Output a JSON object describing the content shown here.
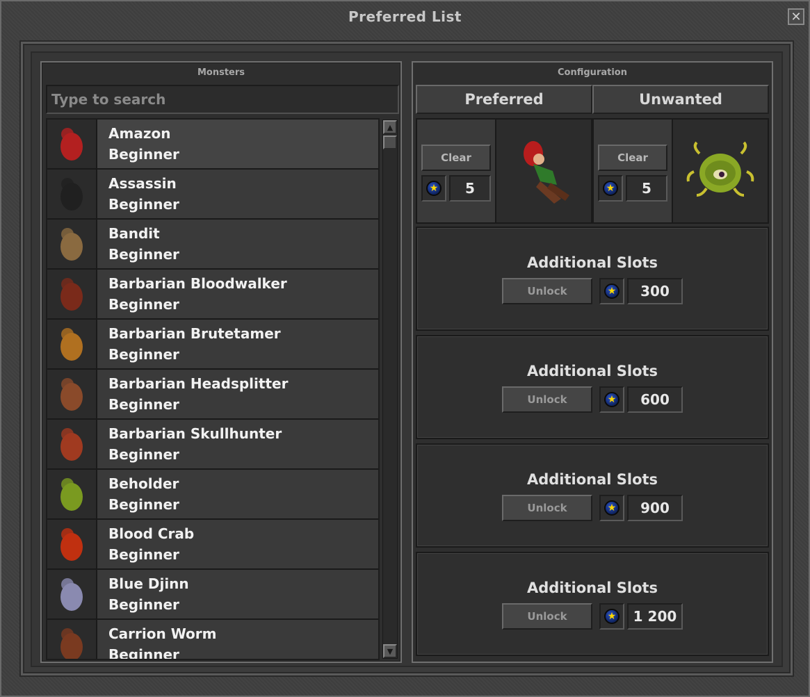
{
  "window": {
    "title": "Preferred List",
    "close_glyph": "✕"
  },
  "monsters": {
    "header": "Monsters",
    "search_placeholder": "Type to search",
    "items": [
      {
        "name": "Amazon",
        "level": "Beginner",
        "icon": "amazon-icon",
        "color": "#b32020"
      },
      {
        "name": "Assassin",
        "level": "Beginner",
        "icon": "assassin-icon",
        "color": "#202020"
      },
      {
        "name": "Bandit",
        "level": "Beginner",
        "icon": "bandit-icon",
        "color": "#8a6a40"
      },
      {
        "name": "Barbarian Bloodwalker",
        "level": "Beginner",
        "icon": "barbarian-bloodwalker-icon",
        "color": "#7a2a1a"
      },
      {
        "name": "Barbarian Brutetamer",
        "level": "Beginner",
        "icon": "barbarian-brutetamer-icon",
        "color": "#b07020"
      },
      {
        "name": "Barbarian Headsplitter",
        "level": "Beginner",
        "icon": "barbarian-headsplitter-icon",
        "color": "#8a4a2a"
      },
      {
        "name": "Barbarian Skullhunter",
        "level": "Beginner",
        "icon": "barbarian-skullhunter-icon",
        "color": "#a03a20"
      },
      {
        "name": "Beholder",
        "level": "Beginner",
        "icon": "beholder-icon",
        "color": "#7a9a20"
      },
      {
        "name": "Blood Crab",
        "level": "Beginner",
        "icon": "blood-crab-icon",
        "color": "#c03010"
      },
      {
        "name": "Blue Djinn",
        "level": "Beginner",
        "icon": "blue-djinn-icon",
        "color": "#8a8ab0"
      },
      {
        "name": "Carrion Worm",
        "level": "Beginner",
        "icon": "carrion-worm-icon",
        "color": "#7a3a20"
      }
    ]
  },
  "configuration": {
    "header": "Configuration",
    "tabs": [
      "Preferred",
      "Unwanted"
    ],
    "preferred": {
      "clear_label": "Clear",
      "count": "5",
      "preview_icon": "amazon-icon"
    },
    "unwanted": {
      "clear_label": "Clear",
      "count": "5",
      "preview_icon": "beholder-icon"
    },
    "additional_slots": [
      {
        "label": "Additional Slots",
        "button": "Unlock",
        "price": "300"
      },
      {
        "label": "Additional Slots",
        "button": "Unlock",
        "price": "600"
      },
      {
        "label": "Additional Slots",
        "button": "Unlock",
        "price": "900"
      },
      {
        "label": "Additional Slots",
        "button": "Unlock",
        "price": "1 200"
      }
    ],
    "coin_icon": "star-coin-icon",
    "coin_glyph": "★"
  }
}
